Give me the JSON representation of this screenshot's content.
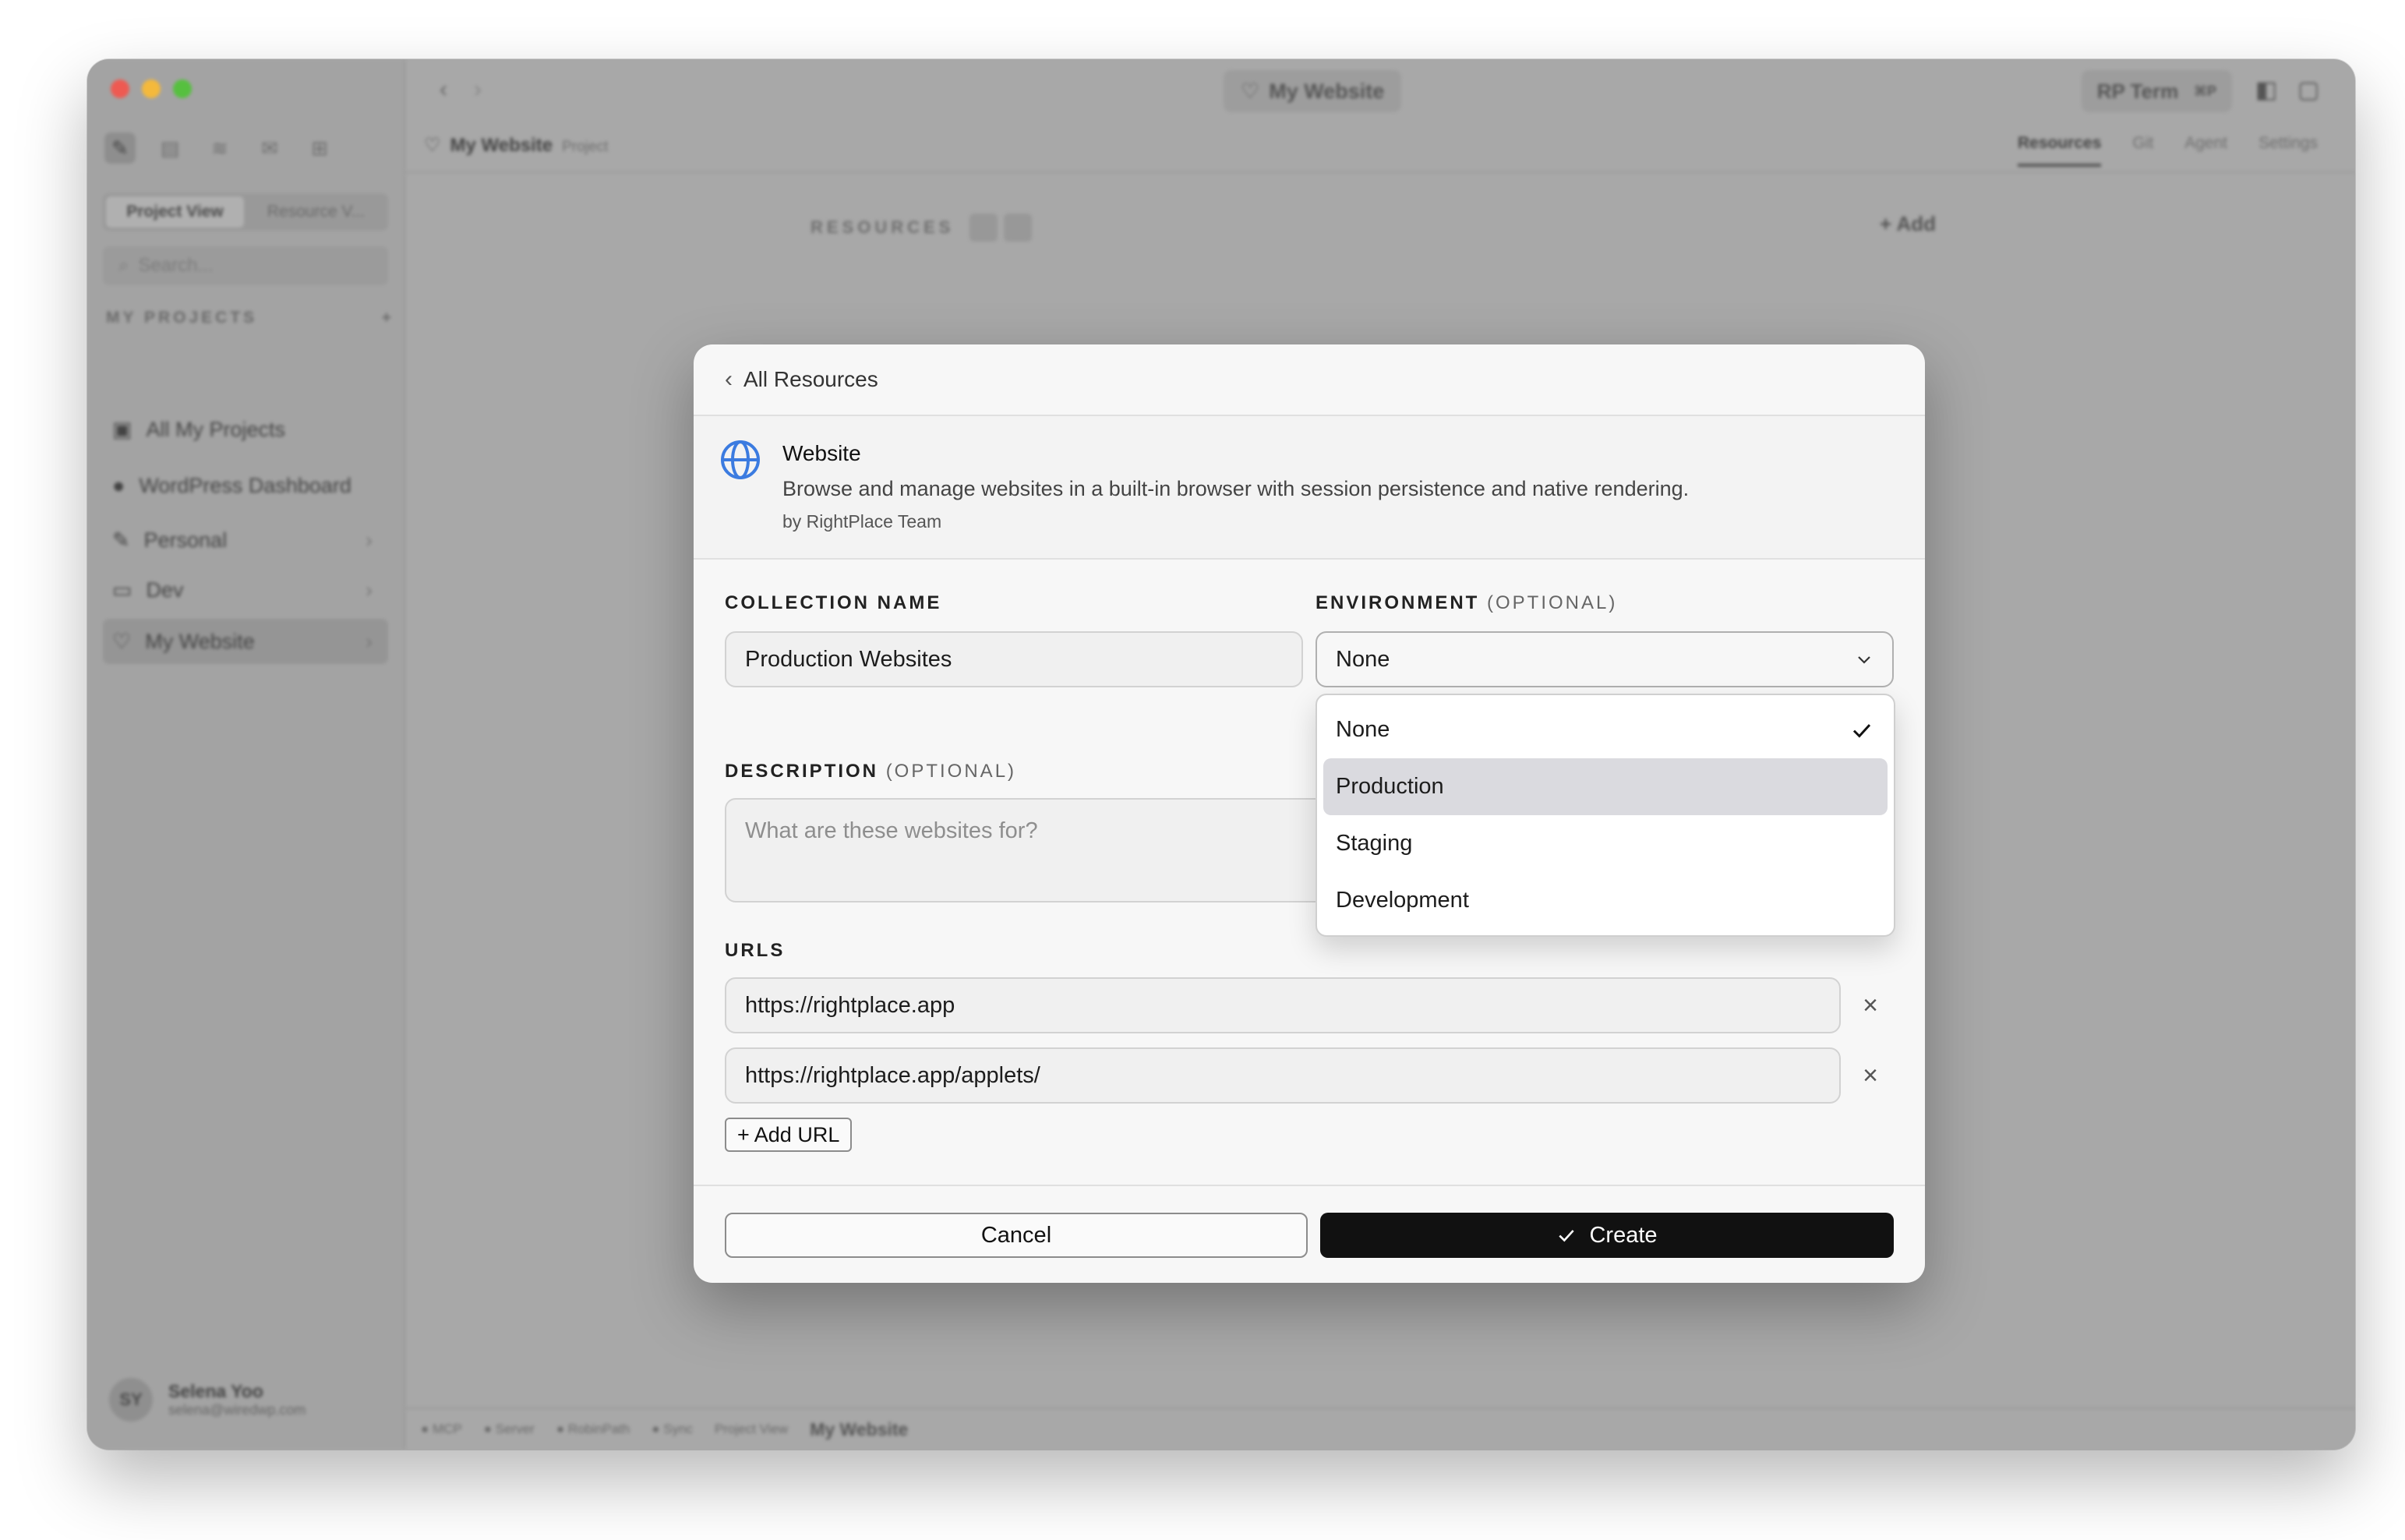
{
  "window": {
    "sidebar": {
      "view_tabs": [
        "Project View",
        "Resource V..."
      ],
      "search_placeholder": "Search...",
      "section_title": "MY PROJECTS",
      "items": [
        {
          "label": "All My Projects",
          "icon": "archive-icon"
        },
        {
          "label": "WordPress Dashboard",
          "icon": "wordpress-icon"
        },
        {
          "label": "Personal",
          "icon": "feather-icon"
        },
        {
          "label": "Dev",
          "icon": "book-icon"
        },
        {
          "label": "My Website",
          "icon": "heart-icon"
        }
      ],
      "user": {
        "initials": "SY",
        "name": "Selena Yoo",
        "email": "selena@wiredwp.com"
      }
    },
    "topbar": {
      "title": "My Website",
      "terminal_label": "RP Term",
      "terminal_shortcut": "⌘P"
    },
    "subbar": {
      "project_name": "My Website",
      "project_kind": "Project",
      "tabs": [
        "Resources",
        "Git",
        "Agent",
        "Settings"
      ]
    },
    "content": {
      "resources_heading": "RESOURCES",
      "add_label": "+ Add"
    },
    "statusbar": {
      "items": [
        "● MCP",
        "● Server",
        "● RobinPath",
        "● Sync",
        "Project View"
      ],
      "workspace": "My Website"
    }
  },
  "modal": {
    "back_label": "All Resources",
    "resource": {
      "title": "Website",
      "description": "Browse and manage websites in a built-in browser with session persistence and native rendering.",
      "author": "by RightPlace Team"
    },
    "collection_name": {
      "label": "COLLECTION NAME",
      "value": "Production Websites"
    },
    "environment": {
      "label": "ENVIRONMENT",
      "optional": "(OPTIONAL)",
      "selected": "None",
      "options": [
        "None",
        "Production",
        "Staging",
        "Development"
      ],
      "highlighted": "Production"
    },
    "description": {
      "label": "DESCRIPTION",
      "optional": "(OPTIONAL)",
      "placeholder": "What are these websites for?"
    },
    "urls": {
      "label": "URLS",
      "items": [
        "https://rightplace.app",
        "https://rightplace.app/applets/"
      ],
      "add_label": "+ Add URL"
    },
    "cancel_label": "Cancel",
    "create_label": "Create",
    "accent_color": "#3b7be0"
  }
}
